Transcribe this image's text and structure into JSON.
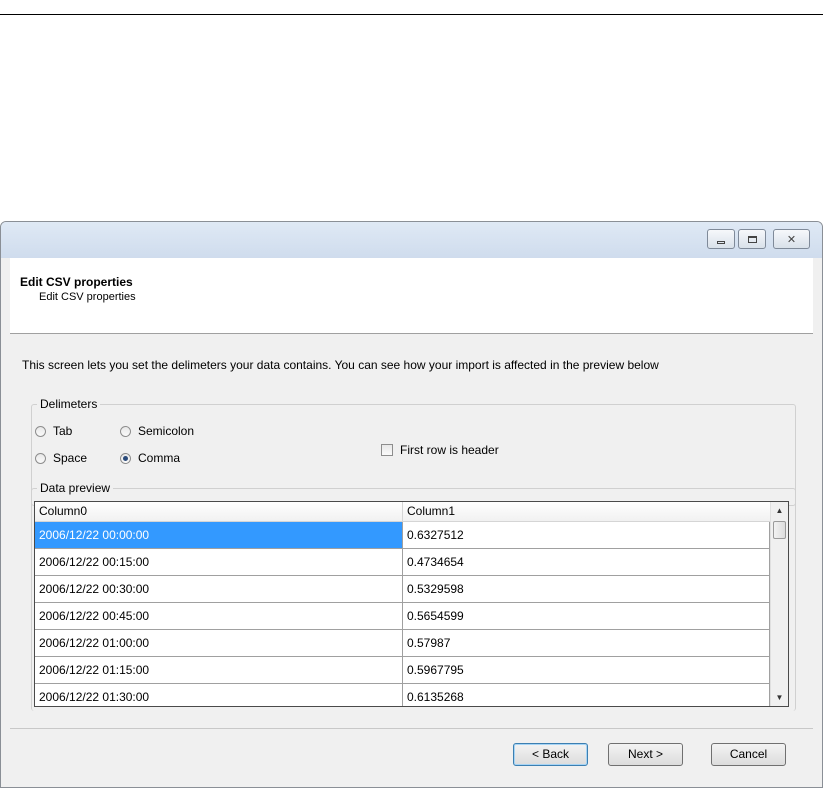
{
  "window": {
    "caption_buttons": {
      "minimize_icon": "minimize-icon",
      "maximize_icon": "maximize-icon",
      "close_icon": "close-icon",
      "close_glyph": "✕"
    }
  },
  "header": {
    "title": "Edit CSV properties",
    "subtitle": "Edit CSV properties"
  },
  "description": "This screen lets you set the delimeters your data contains. You can see how your import is affected in the preview below",
  "delimeters": {
    "group_label": "Delimeters",
    "options": [
      {
        "label": "Tab",
        "checked": false
      },
      {
        "label": "Semicolon",
        "checked": false
      },
      {
        "label": "Space",
        "checked": false
      },
      {
        "label": "Comma",
        "checked": true
      }
    ],
    "first_row_header": {
      "label": "First row is header",
      "checked": false
    }
  },
  "preview": {
    "group_label": "Data preview",
    "columns": [
      "Column0",
      "Column1"
    ],
    "rows": [
      [
        "2006/12/22 00:00:00",
        "0.6327512"
      ],
      [
        "2006/12/22 00:15:00",
        "0.4734654"
      ],
      [
        "2006/12/22 00:30:00",
        "0.5329598"
      ],
      [
        "2006/12/22 00:45:00",
        "0.5654599"
      ],
      [
        "2006/12/22 01:00:00",
        "0.57987"
      ],
      [
        "2006/12/22 01:15:00",
        "0.5967795"
      ],
      [
        "2006/12/22 01:30:00",
        "0.6135268"
      ]
    ],
    "selected_row": 0,
    "scroll_up_glyph": "▲",
    "scroll_down_glyph": "▼"
  },
  "buttons": {
    "back": "< Back",
    "next": "Next >",
    "cancel": "Cancel"
  },
  "colors": {
    "selection": "#3399ff",
    "titlebar": "#dfe9f5",
    "dialog_bg": "#f0f0f0"
  }
}
